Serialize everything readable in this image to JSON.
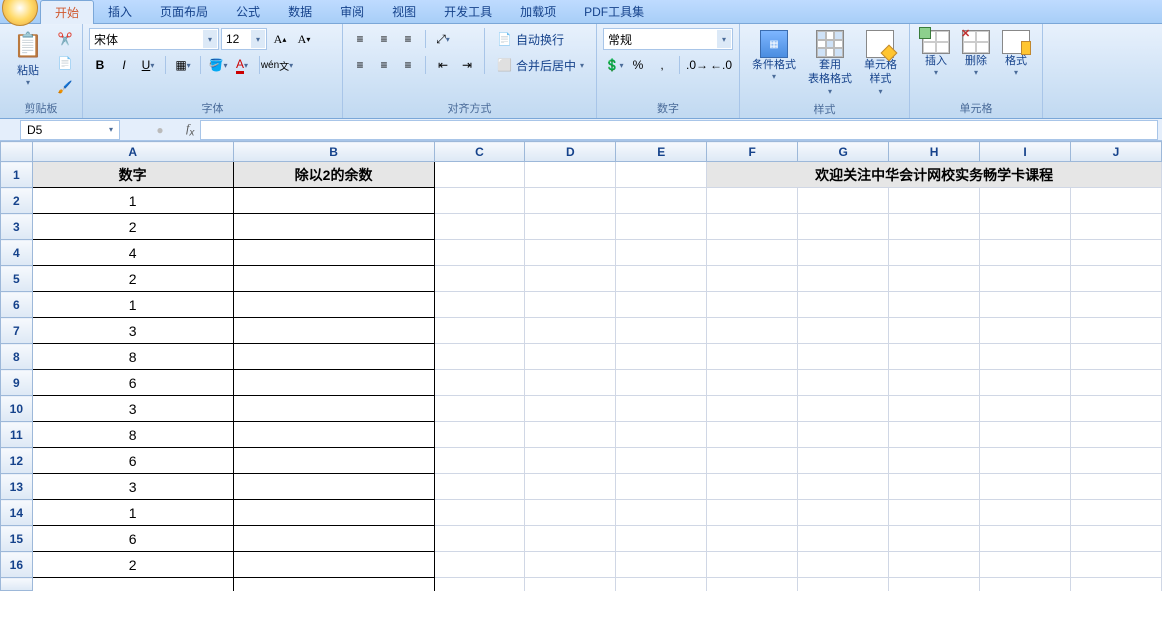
{
  "tabs": {
    "t0": "开始",
    "t1": "插入",
    "t2": "页面布局",
    "t3": "公式",
    "t4": "数据",
    "t5": "审阅",
    "t6": "视图",
    "t7": "开发工具",
    "t8": "加载项",
    "t9": "PDF工具集"
  },
  "groups": {
    "clipboard": "剪贴板",
    "font": "字体",
    "align": "对齐方式",
    "number": "数字",
    "styles": "样式",
    "cells": "单元格"
  },
  "clipboard": {
    "paste": "粘贴"
  },
  "font": {
    "name": "宋体",
    "size": "12"
  },
  "align": {
    "wrap": "自动换行",
    "merge": "合并后居中"
  },
  "number": {
    "format": "常规"
  },
  "styles": {
    "cond": "条件格式",
    "tablefmt": "套用\n表格格式",
    "cellfmt": "单元格\n样式"
  },
  "cells": {
    "insert": "插入",
    "delete": "删除",
    "format": "格式"
  },
  "namebox": "D5",
  "sheet": {
    "cols": [
      "A",
      "B",
      "C",
      "D",
      "E",
      "F",
      "G",
      "H",
      "I",
      "J"
    ],
    "header_a": "数字",
    "header_b": "除以2的余数",
    "banner": "欢迎关注中华会计网校实务畅学卡课程",
    "rows": [
      {
        "n": "2",
        "v": "1"
      },
      {
        "n": "3",
        "v": "2"
      },
      {
        "n": "4",
        "v": "4"
      },
      {
        "n": "5",
        "v": "2"
      },
      {
        "n": "6",
        "v": "1"
      },
      {
        "n": "7",
        "v": "3"
      },
      {
        "n": "8",
        "v": "8"
      },
      {
        "n": "9",
        "v": "6"
      },
      {
        "n": "10",
        "v": "3"
      },
      {
        "n": "11",
        "v": "8"
      },
      {
        "n": "12",
        "v": "6"
      },
      {
        "n": "13",
        "v": "3"
      },
      {
        "n": "14",
        "v": "1"
      },
      {
        "n": "15",
        "v": "6"
      },
      {
        "n": "16",
        "v": "2"
      }
    ]
  }
}
